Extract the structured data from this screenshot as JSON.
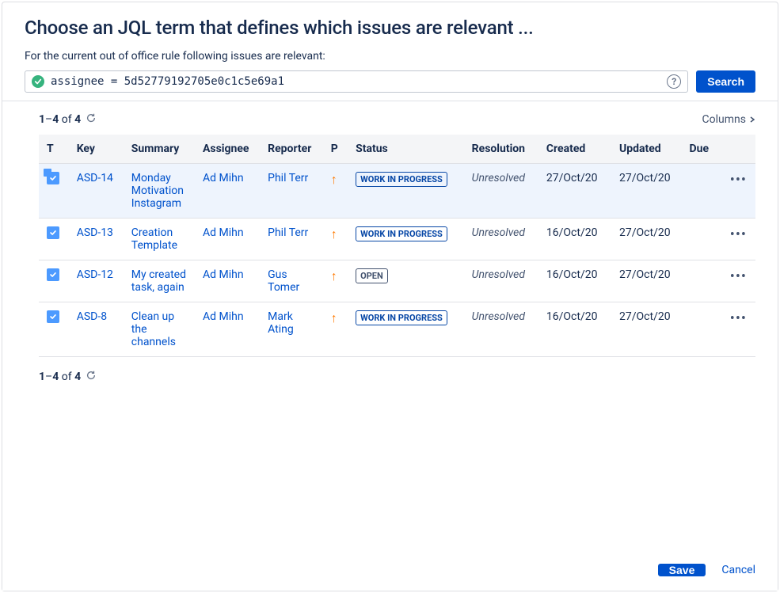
{
  "header": {
    "title": "Choose an JQL term that defines which issues are relevant ...",
    "subtitle": "For the current out of office rule following issues are relevant:"
  },
  "search": {
    "jql": "assignee = 5d52779192705e0c1c5e69a1",
    "button": "Search"
  },
  "pager": {
    "range_start": "1",
    "range_end": "4",
    "of_label": "of",
    "total": "4"
  },
  "columns_menu_label": "Columns",
  "table": {
    "headers": {
      "type": "T",
      "key": "Key",
      "summary": "Summary",
      "assignee": "Assignee",
      "reporter": "Reporter",
      "priority": "P",
      "status": "Status",
      "resolution": "Resolution",
      "created": "Created",
      "updated": "Updated",
      "due": "Due"
    },
    "rows": [
      {
        "key": "ASD-14",
        "summary": "Monday Motivation Instagram",
        "assignee": "Ad Mihn",
        "reporter": "Phil Terr",
        "priority": "medium",
        "status": "WORK IN PROGRESS",
        "status_class": "wip",
        "resolution": "Unresolved",
        "created": "27/Oct/20",
        "updated": "27/Oct/20",
        "due": "",
        "highlight": true,
        "subtask": true
      },
      {
        "key": "ASD-13",
        "summary": "Creation Template",
        "assignee": "Ad Mihn",
        "reporter": "Phil Terr",
        "priority": "medium",
        "status": "WORK IN PROGRESS",
        "status_class": "wip",
        "resolution": "Unresolved",
        "created": "16/Oct/20",
        "updated": "27/Oct/20",
        "due": "",
        "highlight": false,
        "subtask": false
      },
      {
        "key": "ASD-12",
        "summary": "My created task, again",
        "assignee": "Ad Mihn",
        "reporter": "Gus Tomer",
        "priority": "medium",
        "status": "OPEN",
        "status_class": "open",
        "resolution": "Unresolved",
        "created": "16/Oct/20",
        "updated": "27/Oct/20",
        "due": "",
        "highlight": false,
        "subtask": false
      },
      {
        "key": "ASD-8",
        "summary": "Clean up the channels",
        "assignee": "Ad Mihn",
        "reporter": "Mark Ating",
        "priority": "medium",
        "status": "WORK IN PROGRESS",
        "status_class": "wip",
        "resolution": "Unresolved",
        "created": "16/Oct/20",
        "updated": "27/Oct/20",
        "due": "",
        "highlight": false,
        "subtask": false
      }
    ]
  },
  "footer": {
    "save": "Save",
    "cancel": "Cancel"
  }
}
